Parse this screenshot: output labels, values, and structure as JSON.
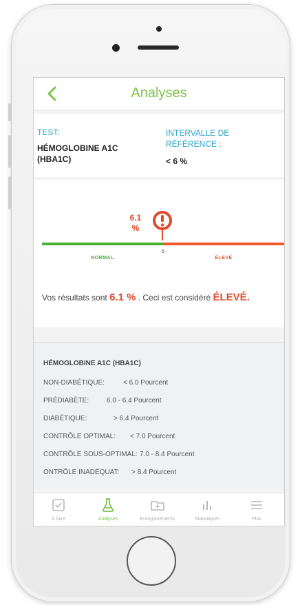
{
  "header": {
    "title": "Analyses"
  },
  "test": {
    "label": "TEST:",
    "name": "HÉMOGLOBINE A1C (HBA1C)",
    "range_label": "INTERVALLE DE RÉFÉRENCE :",
    "range_value": "< 6 %"
  },
  "gauge": {
    "value": "6.1",
    "unit": "%",
    "threshold_label": "6",
    "zone_low": "NORMAL",
    "zone_high": "ÉLEVÉ",
    "low_color": "#4caf35",
    "high_color": "#f05a2b",
    "marker_icon": "exclamation-pin-icon"
  },
  "summary": {
    "prefix": "Vos résultats sont",
    "value": "6.1 %",
    "middle": ". Ceci est considéré",
    "status": "ÉLEVÉ."
  },
  "info": {
    "title": "HÉMOGLOBINE A1C (HBA1C)",
    "rows": [
      {
        "label": "NON-DIABÉTIQUE:",
        "value": "< 6.0  Pourcent"
      },
      {
        "label": "PRÉDIABÈTE:",
        "value": "6.0 - 6.4  Pourcent"
      },
      {
        "label": "DIABÉTIQUE:",
        "value": "> 6.4  Pourcent"
      },
      {
        "label": "CONTRÔLE OPTIMAL:",
        "value": "< 7.0  Pourcent"
      },
      {
        "label": "CONTRÔLE SOUS-OPTIMAL:",
        "value": "7.0 - 8.4  Pourcent"
      },
      {
        "label": "ONTRÔLE INADÉQUAT:",
        "value": "> 8.4  Pourcent"
      }
    ]
  },
  "tabs": [
    {
      "label": "À faire",
      "icon": "checkbox-icon",
      "active": false
    },
    {
      "label": "Analyses",
      "icon": "flask-icon",
      "active": true
    },
    {
      "label": "Enregistrements",
      "icon": "folder-icon",
      "active": false
    },
    {
      "label": "Statistiques",
      "icon": "bar-chart-icon",
      "active": false
    },
    {
      "label": "Plus",
      "icon": "menu-icon",
      "active": false
    }
  ],
  "colors": {
    "accent": "#7cc24a",
    "teal": "#2aa3c9",
    "alert": "#e04a2a"
  }
}
